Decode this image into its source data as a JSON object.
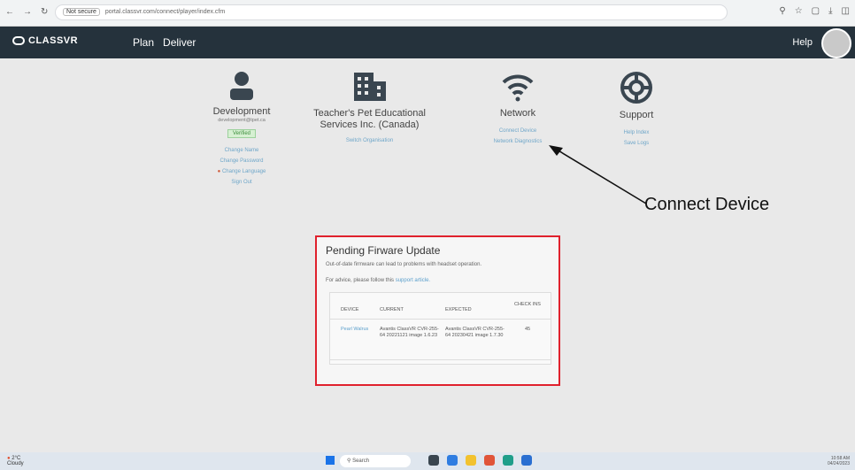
{
  "browser": {
    "security": "Not secure",
    "url": "portal.classvr.com/connect/player/index.cfm"
  },
  "app": {
    "logo": "CLASSVR",
    "menu": [
      "Plan",
      "Deliver"
    ],
    "help": "Help"
  },
  "account": {
    "title": "Development",
    "email": "development@tpet.ca",
    "badge": "Verified",
    "links": [
      "Change Name",
      "Change Password",
      "Change Language",
      "Sign Out"
    ]
  },
  "organisation": {
    "title": "Teacher's Pet Educational Services Inc. (Canada)",
    "link": "Switch Organisation"
  },
  "network": {
    "title": "Network",
    "links": [
      "Connect Device",
      "Network Diagnostics"
    ]
  },
  "support": {
    "title": "Support",
    "links": [
      "Help Index",
      "Save Logs"
    ]
  },
  "callout": "Connect Device",
  "firmware": {
    "title": "Pending Firware Update",
    "line1": "Out-of-date firmware can lead to problems with headset operation.",
    "line2_prefix": "For advice, please follow this",
    "line2_link": "support article.",
    "columns": [
      "DEVICE",
      "CURRENT",
      "EXPECTED",
      "CHECK INS"
    ],
    "rows": [
      {
        "device": "Pearl Walrus",
        "current": "Avantis ClassVR CVR-255-64 20221121 image 1.6.23",
        "expected": "Avantis ClassVR CVR-255-64 20230421 image 1.7.30",
        "checkins": "45"
      }
    ]
  },
  "taskbar": {
    "weather_temp": "2°C",
    "weather_desc": "Cloudy",
    "search": "Search",
    "clock_time": "10:58 AM",
    "clock_date": "04/24/2023"
  }
}
